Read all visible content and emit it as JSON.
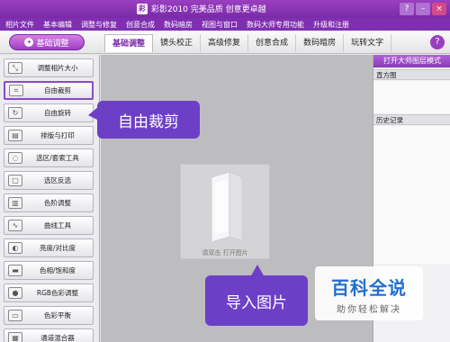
{
  "window": {
    "title": "彩影2010 完美品质 创意更卓越",
    "controls": [
      "?",
      "–",
      "×"
    ]
  },
  "menu": [
    "相片文件",
    "基本编辑",
    "调整与修复",
    "创意合成",
    "数码暗房",
    "视图与窗口",
    "数码大师专用功能",
    "升级和注册"
  ],
  "toolbar": {
    "basic_button": "基础调整",
    "tabs": [
      "基础调整",
      "镜头校正",
      "高级修复",
      "创意合成",
      "数码暗房",
      "玩转文字"
    ],
    "active_tab": "基础调整"
  },
  "tools": [
    {
      "label": "调整相片大小",
      "icon": "resize-icon"
    },
    {
      "label": "自由裁剪",
      "icon": "crop-icon",
      "selected": true
    },
    {
      "label": "自由旋转",
      "icon": "rotate-icon"
    },
    {
      "label": "排版与打印",
      "icon": "print-icon"
    },
    {
      "label": "选区/套索工具",
      "icon": "lasso-icon"
    },
    {
      "label": "选区反选",
      "icon": "invert-selection-icon"
    },
    {
      "label": "色阶调整",
      "icon": "levels-icon"
    },
    {
      "label": "曲线工具",
      "icon": "curves-icon"
    },
    {
      "label": "亮度/对比度",
      "icon": "brightness-icon"
    },
    {
      "label": "色相/饱和度",
      "icon": "hue-icon"
    },
    {
      "label": "RGB色彩调整",
      "icon": "rgb-icon"
    },
    {
      "label": "色彩平衡",
      "icon": "color-balance-icon"
    },
    {
      "label": "通道混合器",
      "icon": "channel-mixer-icon"
    }
  ],
  "right_panel": {
    "open_layers": "打开大师图层模式",
    "histogram": "直方图",
    "history": "历史记录"
  },
  "canvas": {
    "open_hint": "请双击 打开图片"
  },
  "callouts": {
    "crop": "自由裁剪",
    "import": "导入图片"
  },
  "watermark": {
    "title": "百科全说",
    "subtitle": "助你轻松解决"
  }
}
